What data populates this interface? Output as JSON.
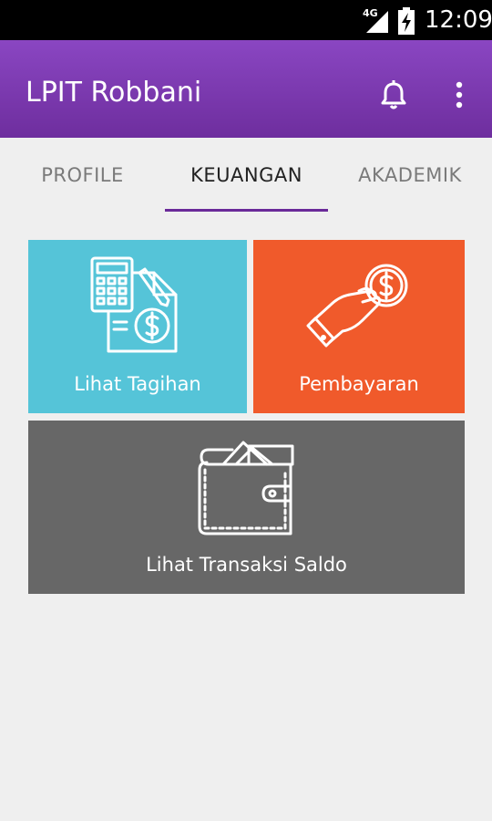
{
  "status_bar": {
    "network": "4G",
    "time": "12:09"
  },
  "app_bar": {
    "title": "LPIT Robbani"
  },
  "tabs": [
    {
      "label": "PROFILE",
      "active": false
    },
    {
      "label": "KEUANGAN",
      "active": true
    },
    {
      "label": "AKADEMIK",
      "active": false
    }
  ],
  "tiles": {
    "tagihan": {
      "label": "Lihat Tagihan",
      "color": "#55c4d8",
      "icon": "calculator-invoice-icon"
    },
    "pembayaran": {
      "label": "Pembayaran",
      "color": "#f05a2b",
      "icon": "hand-coin-icon"
    },
    "saldo": {
      "label": "Lihat Transaksi Saldo",
      "color": "#676767",
      "icon": "wallet-icon"
    }
  },
  "colors": {
    "accent": "#6a2a99",
    "app_bar": "#7d3ab0"
  }
}
